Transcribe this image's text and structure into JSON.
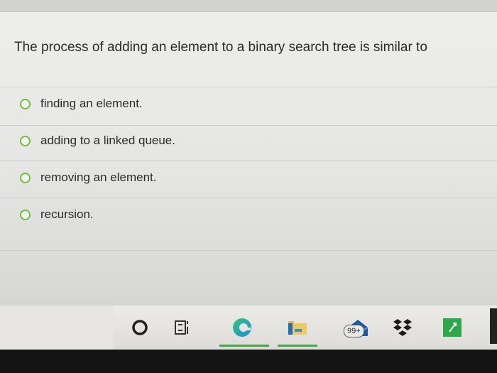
{
  "quiz": {
    "question": "The process of adding an element to a binary search tree is similar to",
    "options": [
      {
        "label": "finding an element."
      },
      {
        "label": "adding to a linked queue."
      },
      {
        "label": "removing an element."
      },
      {
        "label": "recursion."
      }
    ]
  },
  "taskbar": {
    "icons": [
      {
        "name": "cortana-icon"
      },
      {
        "name": "task-view-icon"
      },
      {
        "name": "edge-browser-icon"
      },
      {
        "name": "file-explorer-icon"
      },
      {
        "name": "mail-icon",
        "badge": "99+"
      },
      {
        "name": "dropbox-icon"
      },
      {
        "name": "app-green-icon"
      }
    ]
  },
  "colors": {
    "radio_border": "#6fbf3b",
    "edge_blue": "#1f8fd8",
    "edge_green": "#31c37a",
    "dropbox_dark": "#1a1a1a",
    "app_green": "#2ea84a",
    "explorer_yellow": "#e8b84a"
  }
}
